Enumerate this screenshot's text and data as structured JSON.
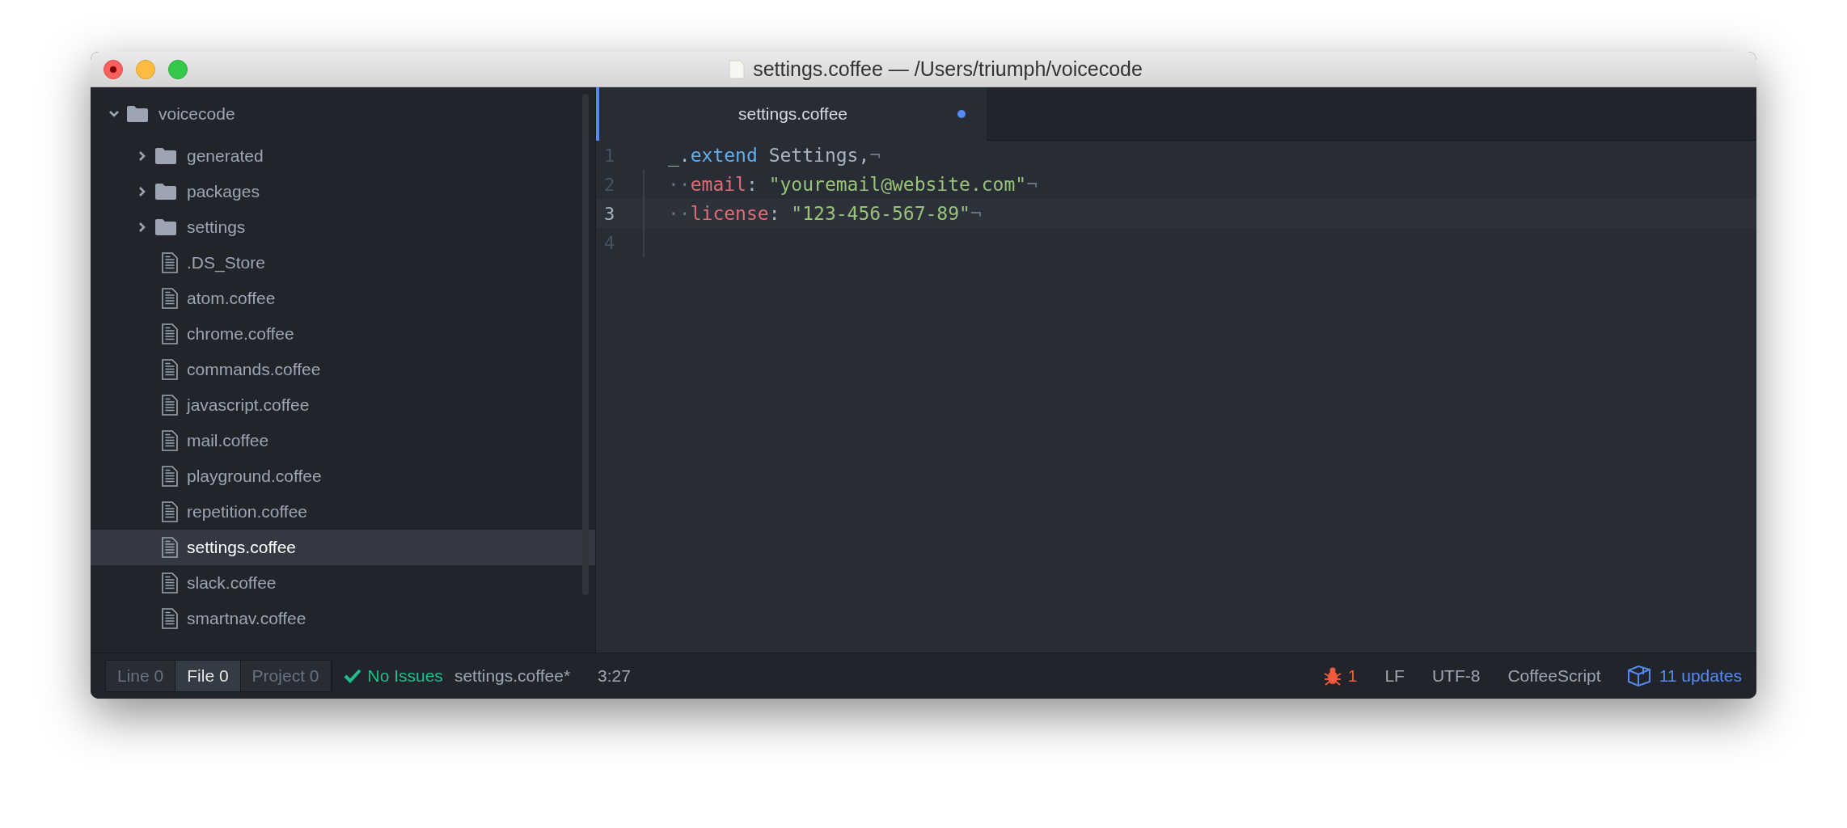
{
  "window": {
    "title": "settings.coffee — /Users/triumph/voicecode"
  },
  "tree": {
    "label": "voicecode",
    "kind": "folder",
    "expanded": true,
    "selected": false,
    "children": [
      {
        "label": "generated",
        "kind": "folder",
        "expanded": false,
        "selected": false
      },
      {
        "label": "packages",
        "kind": "folder",
        "expanded": false,
        "selected": false
      },
      {
        "label": "settings",
        "kind": "folder",
        "expanded": false,
        "selected": false
      },
      {
        "label": ".DS_Store",
        "kind": "file",
        "selected": false
      },
      {
        "label": "atom.coffee",
        "kind": "file",
        "selected": false
      },
      {
        "label": "chrome.coffee",
        "kind": "file",
        "selected": false
      },
      {
        "label": "commands.coffee",
        "kind": "file",
        "selected": false
      },
      {
        "label": "javascript.coffee",
        "kind": "file",
        "selected": false
      },
      {
        "label": "mail.coffee",
        "kind": "file",
        "selected": false
      },
      {
        "label": "playground.coffee",
        "kind": "file",
        "selected": false
      },
      {
        "label": "repetition.coffee",
        "kind": "file",
        "selected": false
      },
      {
        "label": "settings.coffee",
        "kind": "file",
        "selected": true
      },
      {
        "label": "slack.coffee",
        "kind": "file",
        "selected": false
      },
      {
        "label": "smartnav.coffee",
        "kind": "file",
        "selected": false
      }
    ]
  },
  "tabs": [
    {
      "label": "settings.coffee",
      "selected": true,
      "modified": true
    }
  ],
  "editor": {
    "lines": [
      {
        "number": "1",
        "current": false,
        "tokens": [
          {
            "kind": "plain",
            "text": "_."
          },
          {
            "kind": "function",
            "text": "extend"
          },
          {
            "kind": "plain",
            "text": " Settings,"
          },
          {
            "kind": "invisible",
            "text": "¬"
          }
        ]
      },
      {
        "number": "2",
        "current": false,
        "tokens": [
          {
            "kind": "invisible",
            "text": "··"
          },
          {
            "kind": "key",
            "text": "email"
          },
          {
            "kind": "plain",
            "text": ": "
          },
          {
            "kind": "string",
            "text": "\"youremail@website.com\""
          },
          {
            "kind": "invisible",
            "text": "¬"
          }
        ]
      },
      {
        "number": "3",
        "current": true,
        "tokens": [
          {
            "kind": "invisible",
            "text": "··"
          },
          {
            "kind": "key",
            "text": "license"
          },
          {
            "kind": "plain",
            "text": ": "
          },
          {
            "kind": "string",
            "text": "\"123-456-567-89\""
          },
          {
            "kind": "invisible",
            "text": "¬"
          }
        ]
      },
      {
        "number": "4",
        "current": false
      }
    ]
  },
  "status_bar": {
    "linter_tabs": [
      {
        "label": "Line",
        "count": "0",
        "selected": false
      },
      {
        "label": "File",
        "count": "0",
        "selected": true
      },
      {
        "label": "Project",
        "count": "0",
        "selected": false
      }
    ],
    "issues": "No Issues",
    "file": "settings.coffee*",
    "cursor": "3:27",
    "errors": "1",
    "line_ending": "LF",
    "encoding": "UTF-8",
    "grammar": "CoffeeScript",
    "updates": "11 updates"
  }
}
